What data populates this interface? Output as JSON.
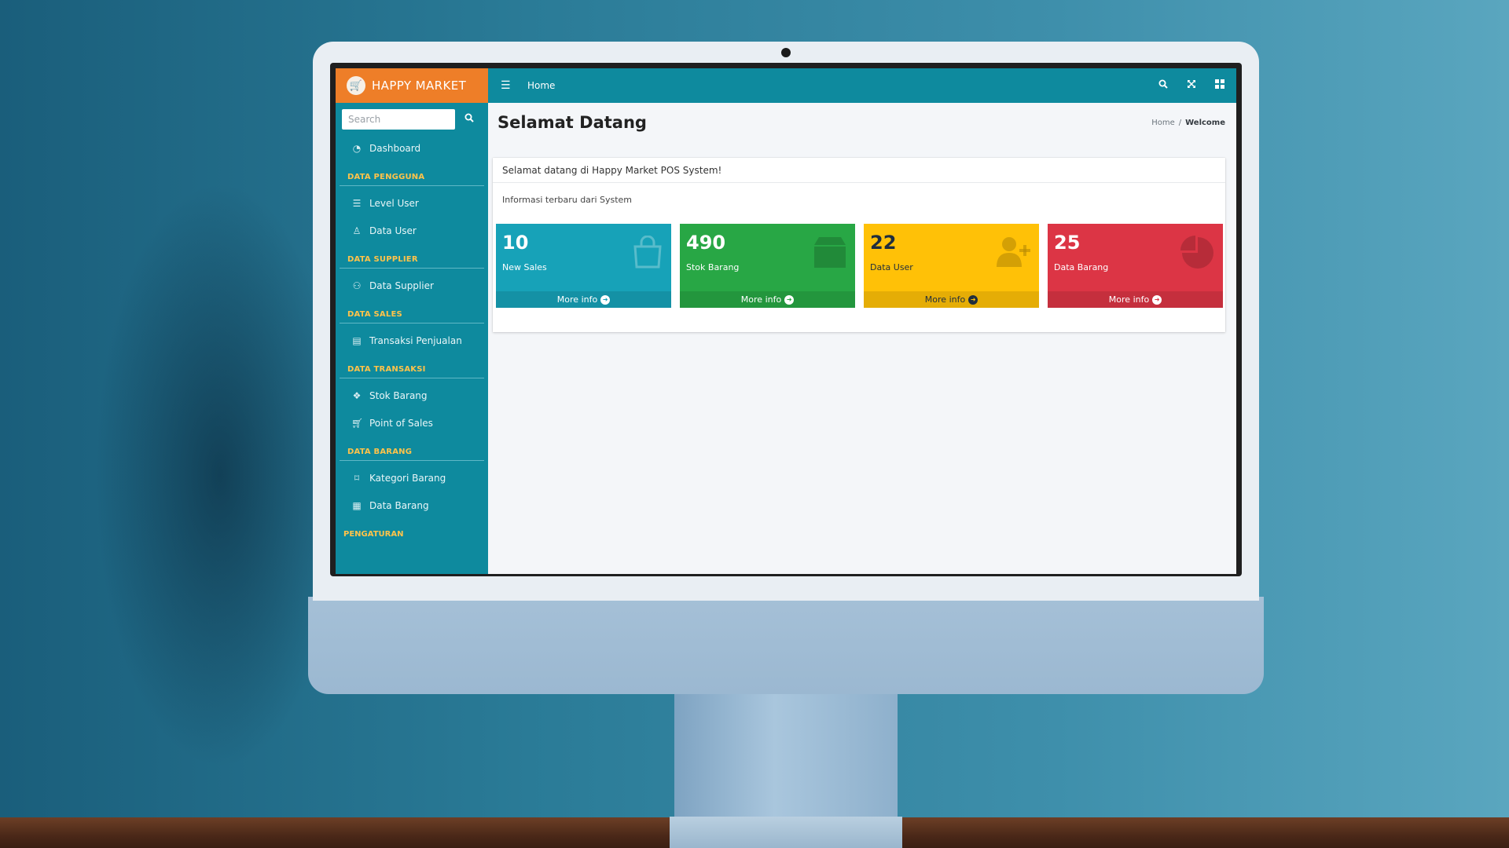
{
  "app": {
    "brand": "HAPPY MARKET",
    "brand_color": "#ee7e28",
    "primary_color": "#0e8a9e"
  },
  "sidebar": {
    "search": {
      "placeholder": "Search"
    },
    "dashboard": "Dashboard",
    "sections": [
      {
        "header": "DATA PENGGUNA",
        "items": [
          "Level User",
          "Data User"
        ]
      },
      {
        "header": "DATA SUPPLIER",
        "items": [
          "Data Supplier"
        ]
      },
      {
        "header": "DATA SALES",
        "items": [
          "Transaksi Penjualan"
        ]
      },
      {
        "header": "DATA TRANSAKSI",
        "items": [
          "Stok Barang",
          "Point of Sales"
        ]
      },
      {
        "header": "DATA BARANG",
        "items": [
          "Kategori Barang",
          "Data Barang"
        ]
      },
      {
        "header": "PENGATURAN",
        "items": []
      }
    ]
  },
  "topbar": {
    "home_link": "Home",
    "icons": [
      "search-icon",
      "expand-icon",
      "grid-icon"
    ]
  },
  "page": {
    "title": "Selamat Datang",
    "breadcrumb": {
      "home": "Home",
      "separator": "/",
      "current": "Welcome"
    }
  },
  "card": {
    "header": "Selamat datang di Happy Market POS System!",
    "subtitle": "Informasi terbaru dari System"
  },
  "boxes": [
    {
      "value": "10",
      "label": "New Sales",
      "footer": "More info",
      "color": "#17a2b8",
      "icon": "shopping-bag-icon"
    },
    {
      "value": "490",
      "label": "Stok Barang",
      "footer": "More info",
      "color": "#28a745",
      "icon": "box-icon"
    },
    {
      "value": "22",
      "label": "Data User",
      "footer": "More info",
      "color": "#ffc107",
      "icon": "user-plus-icon"
    },
    {
      "value": "25",
      "label": "Data Barang",
      "footer": "More info",
      "color": "#dc3545",
      "icon": "pie-chart-icon"
    }
  ]
}
